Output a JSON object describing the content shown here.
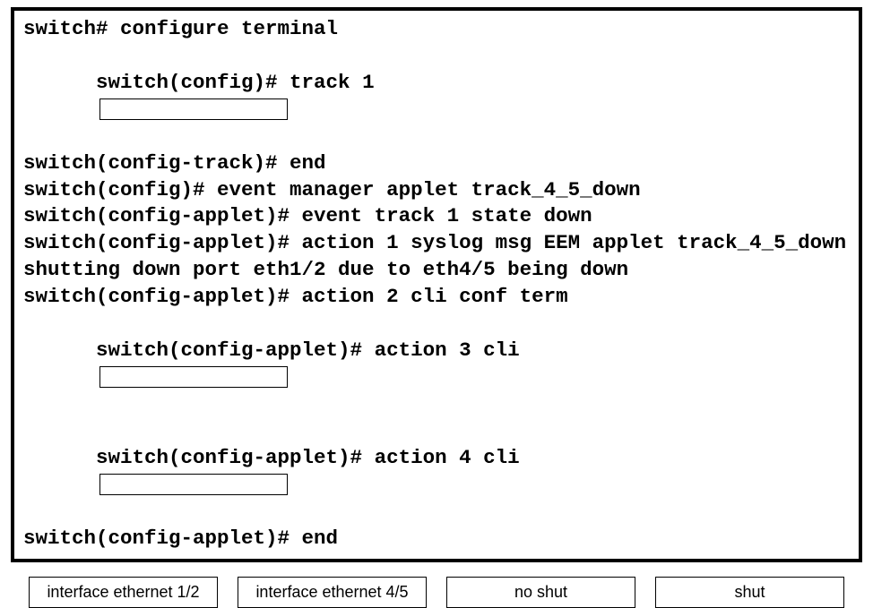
{
  "terminal": {
    "l1": "switch# configure terminal",
    "l2a": "switch(config)# track 1",
    "l3": "switch(config-track)# end",
    "l4": "",
    "l5": "switch(config)# event manager applet track_4_5_down",
    "l6": "switch(config-applet)# event track 1 state down",
    "l7": "switch(config-applet)# action 1 syslog msg EEM applet track_4_5_down shutting down port eth1/2 due to eth4/5 being down",
    "l8": "switch(config-applet)# action 2 cli conf term",
    "l9a": "switch(config-applet)# action 3 cli",
    "l10a": "switch(config-applet)# action 4 cli",
    "l11": "switch(config-applet)# end"
  },
  "choices": {
    "c1": "interface ethernet 1/2",
    "c2": "interface ethernet 4/5",
    "c3": "no shut",
    "c4": "shut"
  }
}
